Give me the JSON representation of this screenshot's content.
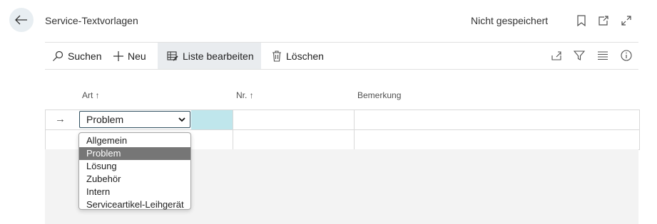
{
  "header": {
    "title": "Service-Textvorlagen",
    "status": "Nicht gespeichert"
  },
  "actions": {
    "search": "Suchen",
    "new": "Neu",
    "edit_list": "Liste bearbeiten",
    "delete": "Löschen"
  },
  "grid": {
    "columns": [
      "Art ↑",
      "Nr. ↑",
      "Bemerkung"
    ],
    "row_arrow": "→",
    "selected_value": "Problem"
  },
  "dropdown": {
    "options": [
      "Allgemein",
      "Problem",
      "Lösung",
      "Zubehör",
      "Intern",
      "Serviceartikel-Leihgerät"
    ],
    "highlighted": "Problem"
  },
  "colors": {
    "accent": "#bfe6ec",
    "selected_option": "#767676",
    "toolbar_active": "#e9ecef"
  }
}
